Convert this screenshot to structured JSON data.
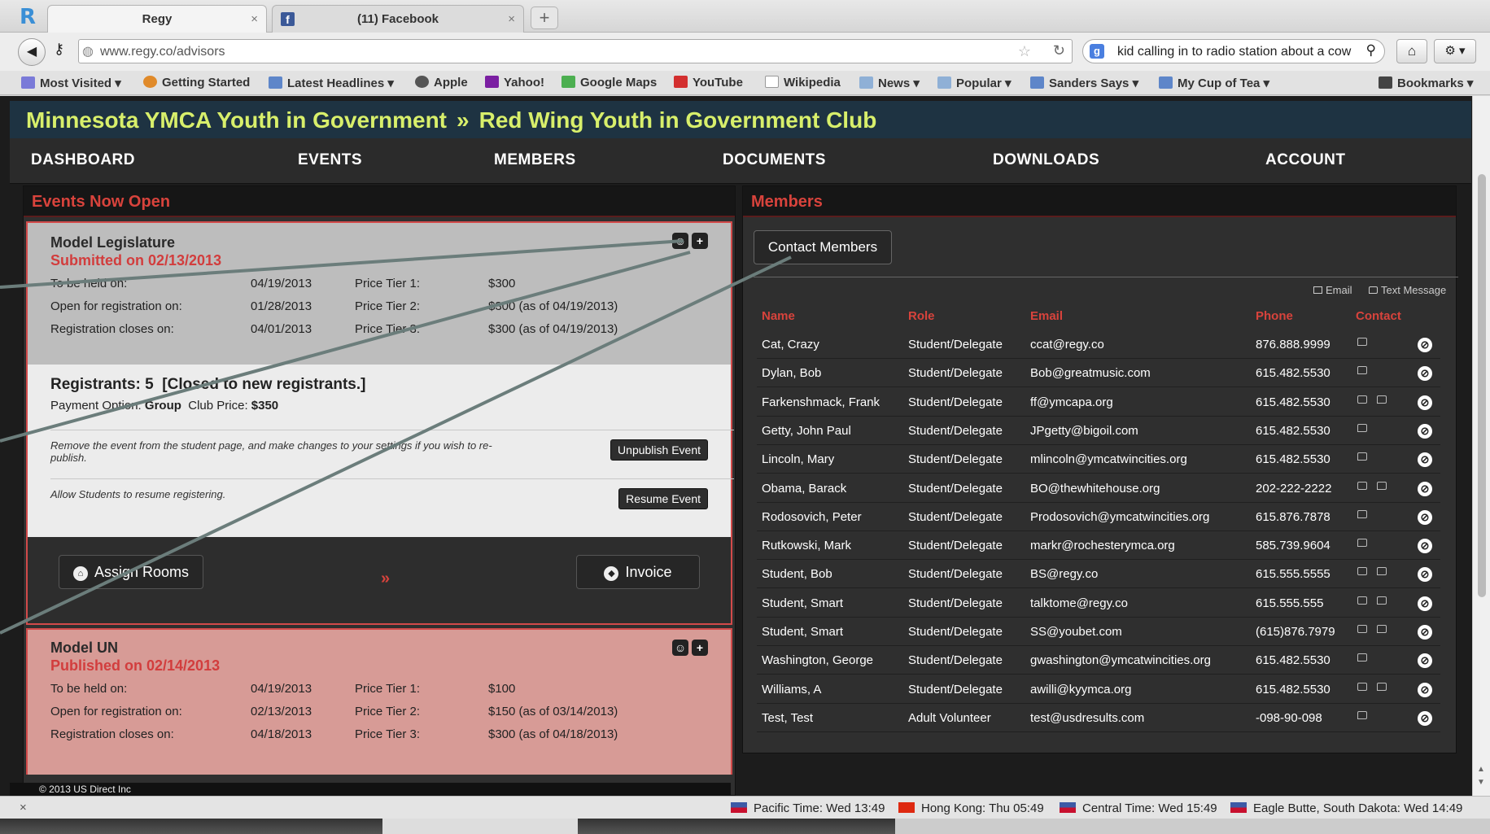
{
  "browser": {
    "tabs": [
      {
        "title": "Regy",
        "active": true
      },
      {
        "title": "(11) Facebook",
        "active": false
      }
    ],
    "url": "www.regy.co/advisors",
    "search_text": "kid calling in to radio station about a cow",
    "bookmarks": [
      "Most Visited",
      "Getting Started",
      "Latest Headlines",
      "Apple",
      "Yahoo!",
      "Google Maps",
      "YouTube",
      "Wikipedia",
      "News",
      "Popular",
      "Sanders  Says",
      "My Cup of Tea",
      "Bookmarks"
    ]
  },
  "site": {
    "org": "Minnesota YMCA Youth in Government",
    "separator": "»",
    "club": "Red Wing Youth in Government Club",
    "nav": [
      "DASHBOARD",
      "EVENTS",
      "MEMBERS",
      "DOCUMENTS",
      "DOWNLOADS",
      "ACCOUNT"
    ]
  },
  "events_panel": {
    "title": "Events Now Open",
    "event1": {
      "name": "Model Legislature",
      "status": "Submitted on 02/13/2013",
      "rows": [
        {
          "label": "To be held on:",
          "date": "04/19/2013",
          "tier": "Price Tier 1:",
          "price": "$300"
        },
        {
          "label": "Open for registration on:",
          "date": "01/28/2013",
          "tier": "Price Tier 2:",
          "price": "$300 (as of 04/19/2013)"
        },
        {
          "label": "Registration closes on:",
          "date": "04/01/2013",
          "tier": "Price Tier 3:",
          "price": "$300 (as of 04/19/2013)"
        }
      ],
      "registrants": "Registrants: 5",
      "closed": "[Closed to new registrants.]",
      "payment_label": "Payment Option:",
      "payment_value": "Group",
      "club_price_label": "Club Price:",
      "club_price_value": "$350",
      "unpublish_note": "Remove the event from the student page, and make changes to your settings if you wish to re-publish.",
      "unpublish_label": "Unpublish Event",
      "resume_note": "Allow Students to resume registering.",
      "resume_label": "Resume Event",
      "assign_label": "Assign Rooms",
      "invoice_label": "Invoice",
      "chevron": "»"
    },
    "event2": {
      "name": "Model UN",
      "status": "Published on 02/14/2013",
      "rows": [
        {
          "label": "To be held on:",
          "date": "04/19/2013",
          "tier": "Price Tier 1:",
          "price": "$100"
        },
        {
          "label": "Open for registration on:",
          "date": "02/13/2013",
          "tier": "Price Tier 2:",
          "price": "$150 (as of 03/14/2013)"
        },
        {
          "label": "Registration closes on:",
          "date": "04/18/2013",
          "tier": "Price Tier 3:",
          "price": "$300 (as of 04/18/2013)"
        }
      ]
    },
    "footer": "© 2013 US Direct Inc"
  },
  "members_panel": {
    "title": "Members",
    "contact_button": "Contact Members",
    "legend_email": "Email",
    "legend_text": "Text Message",
    "columns": [
      "Name",
      "Role",
      "Email",
      "Phone",
      "Contact"
    ],
    "rows": [
      {
        "name": "Cat, Crazy",
        "role": "Student/Delegate",
        "email": "ccat@regy.co",
        "phone": "876.888.9999",
        "contact": "sms"
      },
      {
        "name": "Dylan, Bob",
        "role": "Student/Delegate",
        "email": "Bob@greatmusic.com",
        "phone": "615.482.5530",
        "contact": "sms"
      },
      {
        "name": "Farkenshmack, Frank",
        "role": "Student/Delegate",
        "email": "ff@ymcapa.org",
        "phone": "615.482.5530",
        "contact": "both"
      },
      {
        "name": "Getty, John Paul",
        "role": "Student/Delegate",
        "email": "JPgetty@bigoil.com",
        "phone": "615.482.5530",
        "contact": "sms"
      },
      {
        "name": "Lincoln, Mary",
        "role": "Student/Delegate",
        "email": "mlincoln@ymcatwincities.org",
        "phone": "615.482.5530",
        "contact": "sms"
      },
      {
        "name": "Obama, Barack",
        "role": "Student/Delegate",
        "email": "BO@thewhitehouse.org",
        "phone": "202-222-2222",
        "contact": "both"
      },
      {
        "name": "Rodosovich, Peter",
        "role": "Student/Delegate",
        "email": "Prodosovich@ymcatwincities.org",
        "phone": "615.876.7878",
        "contact": "sms"
      },
      {
        "name": "Rutkowski, Mark",
        "role": "Student/Delegate",
        "email": "markr@rochesterymca.org",
        "phone": "585.739.9604",
        "contact": "sms"
      },
      {
        "name": "Student, Bob",
        "role": "Student/Delegate",
        "email": "BS@regy.co",
        "phone": "615.555.5555",
        "contact": "both"
      },
      {
        "name": "Student, Smart",
        "role": "Student/Delegate",
        "email": "talktome@regy.co",
        "phone": "615.555.555",
        "contact": "both"
      },
      {
        "name": "Student, Smart",
        "role": "Student/Delegate",
        "email": "SS@youbet.com",
        "phone": "(615)876.7979",
        "contact": "both"
      },
      {
        "name": "Washington, George",
        "role": "Student/Delegate",
        "email": "gwashington@ymcatwincities.org",
        "phone": "615.482.5530",
        "contact": "sms"
      },
      {
        "name": "Williams, A",
        "role": "Student/Delegate",
        "email": "awilli@kyymca.org",
        "phone": "615.482.5530",
        "contact": "both"
      },
      {
        "name": "Test, Test",
        "role": "Adult Volunteer",
        "email": "test@usdresults.com",
        "phone": "-098-90-098",
        "contact": "sms"
      }
    ]
  },
  "statusbar": {
    "clocks": [
      "Pacific Time: Wed 13:49",
      "Hong Kong: Thu 05:49",
      "Central Time: Wed 15:49",
      "Eagle Butte, South Dakota: Wed 14:49"
    ]
  }
}
